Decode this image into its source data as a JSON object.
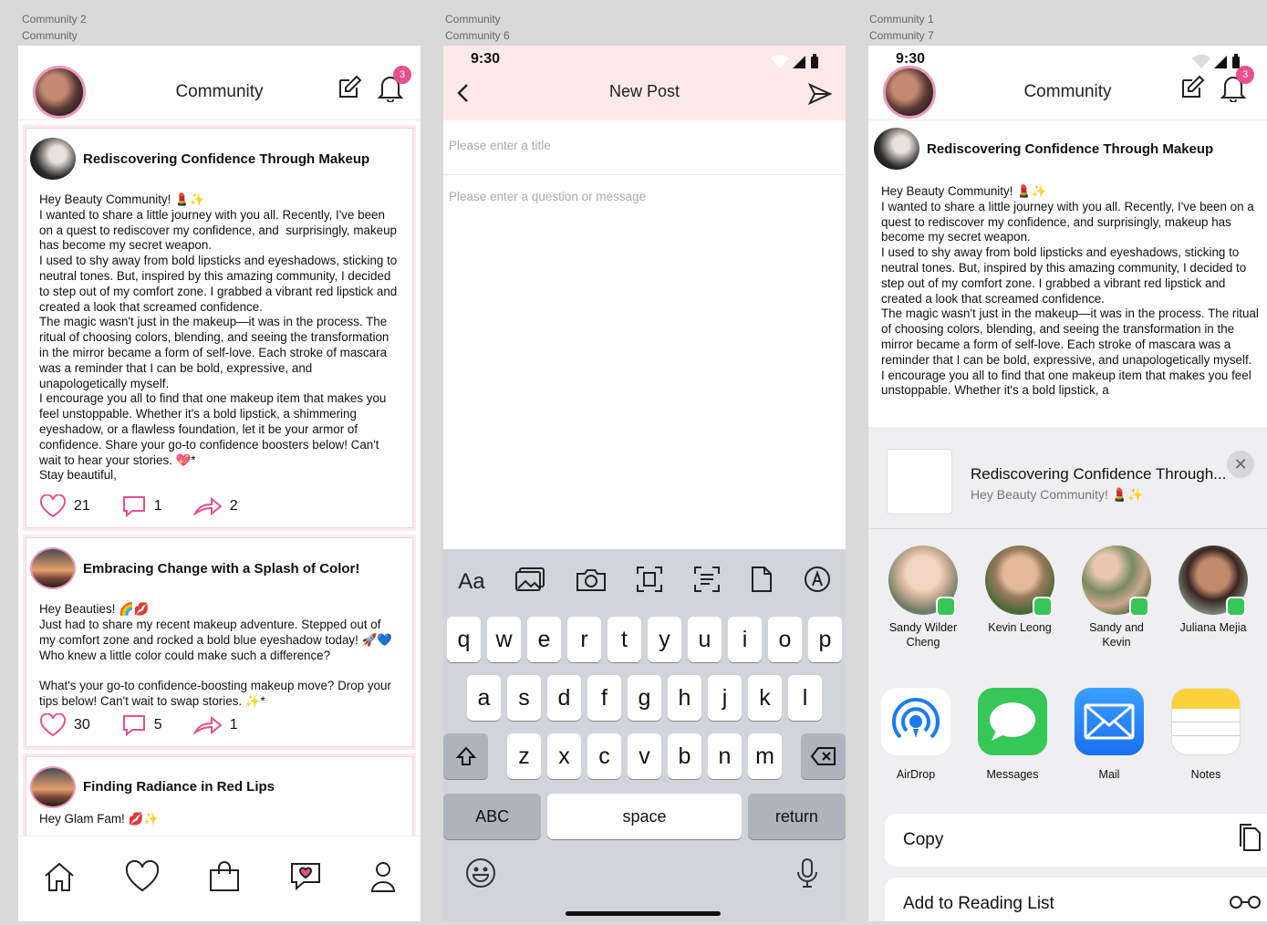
{
  "frame_labels": {
    "f1": [
      "Community 2",
      "Community"
    ],
    "f2": [
      "Community",
      "Community 6"
    ],
    "f3": [
      "Community 1",
      "Community 7"
    ]
  },
  "status": {
    "time": "9:30"
  },
  "community": {
    "title": "Community",
    "notif_count": "3",
    "posts": [
      {
        "title": "Rediscovering Confidence Through Makeup",
        "body": "Hey Beauty Community! 💄✨\nI wanted to share a little journey with you all. Recently, I've been on a quest to rediscover my confidence, and  surprisingly, makeup has become my secret weapon.\nI used to shy away from bold lipsticks and eyeshadows, sticking to neutral tones. But, inspired by this amazing community, I decided to step out of my comfort zone. I grabbed a vibrant red lipstick and created a look that screamed confidence.\nThe magic wasn't just in the makeup—it was in the process. The ritual of choosing colors, blending, and seeing the transformation in the mirror became a form of self-love. Each stroke of mascara was a reminder that I can be bold, expressive, and unapologetically myself.\nI encourage you all to find that one makeup item that makes you feel unstoppable. Whether it's a bold lipstick, a shimmering eyeshadow, or a flawless foundation, let it be your armor of confidence. Share your go-to confidence boosters below! Can't wait to hear your stories. 💖*\nStay beautiful,",
        "likes": "21",
        "comments": "1",
        "shares": "2"
      },
      {
        "title": "Embracing Change with a Splash of Color!",
        "body": "Hey Beauties! 🌈💋\nJust had to share my recent makeup adventure. Stepped out of my comfort zone and rocked a bold blue eyeshadow today! 🚀💙 Who knew a little color could make such a difference?\n\nWhat's your go-to confidence-boosting makeup move? Drop your tips below! Can't wait to swap stories. ✨*",
        "likes": "30",
        "comments": "5",
        "shares": "1"
      },
      {
        "title": "Finding Radiance in Red Lips",
        "body": "Hey Glam Fam! 💋✨"
      }
    ]
  },
  "share_post_body": "Hey Beauty Community! 💄✨\nI wanted to share a little journey with you all. Recently, I've been on a quest to rediscover my confidence, and surprisingly, makeup has become my secret weapon.\nI used to shy away from bold lipsticks and eyeshadows, sticking to neutral tones. But, inspired by this amazing community, I decided to step out of my comfort zone. I grabbed a vibrant red lipstick and created a look that screamed confidence.\nThe magic wasn't just in the makeup—it was in the process. The ritual of choosing colors, blending, and seeing the transformation in the mirror became a form of self-love. Each stroke of mascara was a reminder that I can be bold, expressive, and unapologetically myself.\nI encourage you all to find that one makeup item that makes you feel unstoppable. Whether it's a bold lipstick, a",
  "new_post": {
    "title": "New Post",
    "title_placeholder": "Please enter a title",
    "message_placeholder": "Please enter a question or message",
    "toolbar_text": "Aa",
    "keys_row1": [
      "q",
      "w",
      "e",
      "r",
      "t",
      "y",
      "u",
      "i",
      "o",
      "p"
    ],
    "keys_row2": [
      "a",
      "s",
      "d",
      "f",
      "g",
      "h",
      "j",
      "k",
      "l"
    ],
    "keys_row3": [
      "z",
      "x",
      "c",
      "v",
      "b",
      "n",
      "m"
    ],
    "abc": "ABC",
    "space": "space",
    "return": "return"
  },
  "share": {
    "preview_title": "Rediscovering Confidence Through...",
    "preview_sub": "Hey Beauty Community! 💄✨",
    "people": [
      {
        "name": "Sandy Wilder Cheng"
      },
      {
        "name": "Kevin Leong"
      },
      {
        "name": "Sandy and Kevin"
      },
      {
        "name": "Juliana Mejia"
      }
    ],
    "apps": [
      {
        "name": "AirDrop",
        "icon": "airdrop-icon"
      },
      {
        "name": "Messages",
        "icon": "messages-icon"
      },
      {
        "name": "Mail",
        "icon": "mail-icon"
      },
      {
        "name": "Notes",
        "icon": "notes-icon"
      }
    ],
    "actions": [
      {
        "label": "Copy",
        "icon": "copy-icon"
      },
      {
        "label": "Add to Reading List",
        "icon": "glasses-icon"
      }
    ]
  },
  "colors": {
    "accent": "#e84f8c",
    "pink_bg": "#fde8ea",
    "avatar_ring": "#e99ab7",
    "messages_green": "#37c759",
    "mail_blue": "#1a7cf5"
  }
}
